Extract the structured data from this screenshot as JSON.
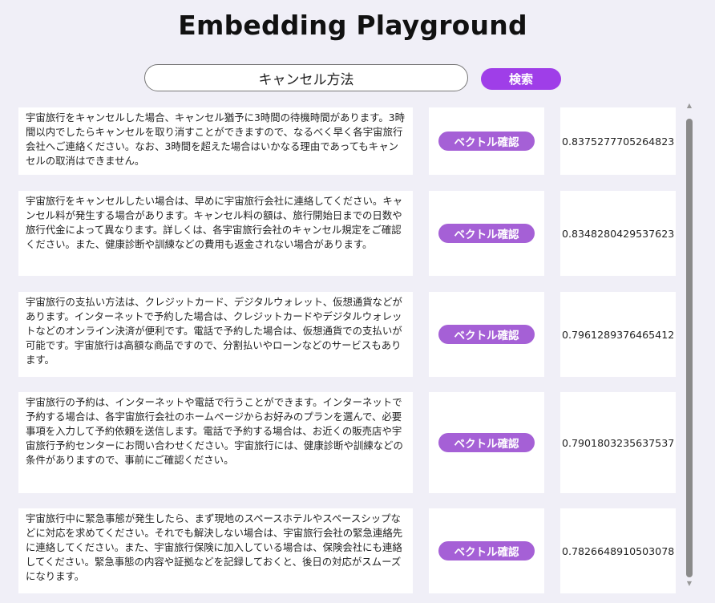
{
  "header": {
    "title": "Embedding Playground"
  },
  "search": {
    "value": "キャンセル方法",
    "button_label": "検索"
  },
  "results": [
    {
      "text": "宇宙旅行をキャンセルした場合、キャンセル猶予に3時間の待機時間があります。3時間以内でしたらキャンセルを取り消すことができますので、なるべく早く各宇宙旅行会社へご連絡ください。なお、3時間を超えた場合はいかなる理由であってもキャンセルの取消はできません。",
      "button_label": "ベクトル確認",
      "score": "0.8375277705264823"
    },
    {
      "text": "宇宙旅行をキャンセルしたい場合は、早めに宇宙旅行会社に連絡してください。キャンセル料が発生する場合があります。キャンセル料の額は、旅行開始日までの日数や旅行代金によって異なります。詳しくは、各宇宙旅行会社のキャンセル規定をご確認ください。また、健康診断や訓練などの費用も返金されない場合があります。",
      "button_label": "ベクトル確認",
      "score": "0.8348280429537623"
    },
    {
      "text": "宇宙旅行の支払い方法は、クレジットカード、デジタルウォレット、仮想通貨などがあります。インターネットで予約した場合は、クレジットカードやデジタルウォレットなどのオンライン決済が便利です。電話で予約した場合は、仮想通貨での支払いが可能です。宇宙旅行は高額な商品ですので、分割払いやローンなどのサービスもあります。",
      "button_label": "ベクトル確認",
      "score": "0.7961289376465412"
    },
    {
      "text": "宇宙旅行の予約は、インターネットや電話で行うことができます。インターネットで予約する場合は、各宇宙旅行会社のホームページからお好みのプランを選んで、必要事項を入力して予約依頼を送信します。電話で予約する場合は、お近くの販売店や宇宙旅行予約センターにお問い合わせください。宇宙旅行には、健康診断や訓練などの条件がありますので、事前にご確認ください。",
      "button_label": "ベクトル確認",
      "score": "0.7901803235637537"
    },
    {
      "text": "宇宙旅行中に緊急事態が発生したら、まず現地のスペースホテルやスペースシップなどに対応を求めてください。それでも解決しない場合は、宇宙旅行会社の緊急連絡先に連絡してください。また、宇宙旅行保険に加入している場合は、保険会社にも連絡してください。緊急事態の内容や証拠などを記録しておくと、後日の対応がスムーズになります。",
      "button_label": "ベクトル確認",
      "score": "0.7826648910503078"
    }
  ]
}
